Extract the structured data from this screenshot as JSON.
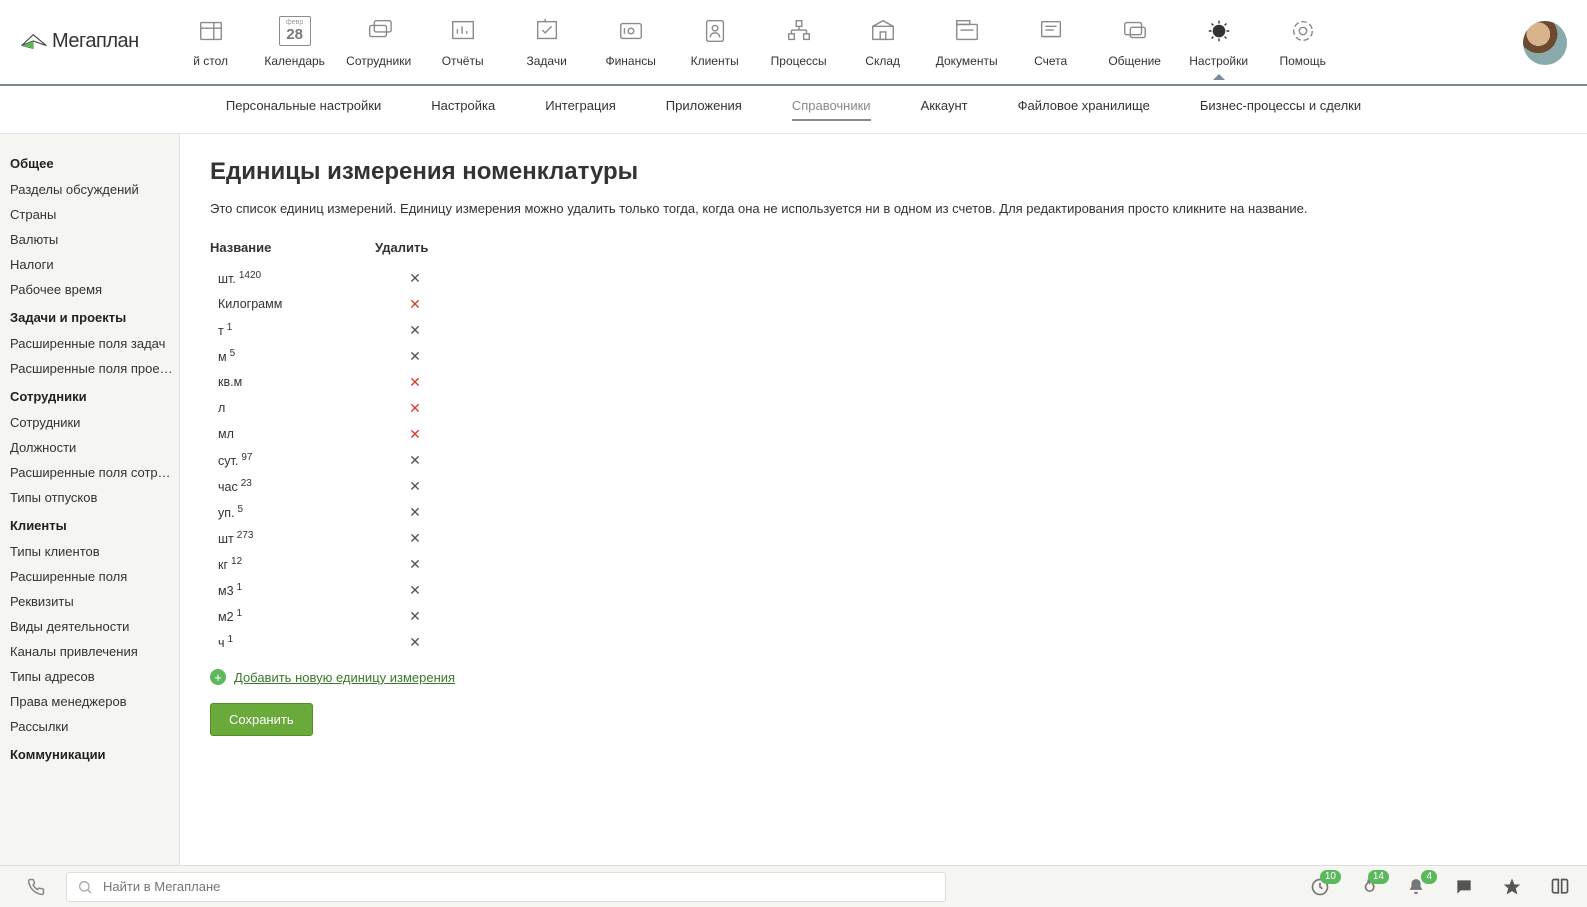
{
  "logo_text": "Мегаплан",
  "top_nav": [
    {
      "label": "й стол"
    },
    {
      "label": "Календарь",
      "badge": "28",
      "badge_top": "февр"
    },
    {
      "label": "Сотрудники"
    },
    {
      "label": "Отчёты"
    },
    {
      "label": "Задачи"
    },
    {
      "label": "Финансы"
    },
    {
      "label": "Клиенты"
    },
    {
      "label": "Процессы"
    },
    {
      "label": "Склад"
    },
    {
      "label": "Документы"
    },
    {
      "label": "Счета"
    },
    {
      "label": "Общение"
    },
    {
      "label": "Настройки",
      "active": true
    },
    {
      "label": "Помощь"
    }
  ],
  "sub_nav": [
    {
      "label": "Персональные настройки"
    },
    {
      "label": "Настройка"
    },
    {
      "label": "Интеграция"
    },
    {
      "label": "Приложения"
    },
    {
      "label": "Справочники",
      "active": true
    },
    {
      "label": "Аккаунт"
    },
    {
      "label": "Файловое хранилище"
    },
    {
      "label": "Бизнес-процессы и сделки"
    }
  ],
  "sidebar": [
    {
      "title": "Общее",
      "items": [
        "Разделы обсуждений",
        "Страны",
        "Валюты",
        "Налоги",
        "Рабочее время"
      ]
    },
    {
      "title": "Задачи и проекты",
      "items": [
        "Расширенные поля задач",
        "Расширенные поля проек..."
      ]
    },
    {
      "title": "Сотрудники",
      "items": [
        "Сотрудники",
        "Должности",
        "Расширенные поля сотру...",
        "Типы отпусков"
      ]
    },
    {
      "title": "Клиенты",
      "items": [
        "Типы клиентов",
        "Расширенные поля",
        "Реквизиты",
        "Виды деятельности",
        "Каналы привлечения",
        "Типы адресов",
        "Права менеджеров",
        "Рассылки"
      ]
    },
    {
      "title": "Коммуникации",
      "items": []
    }
  ],
  "page": {
    "title": "Единицы измерения номенклатуры",
    "desc": "Это список единиц измерений. Единицу измерения можно удалить только тогда, когда она не используется ни в одном из счетов. Для редактирования просто кликните на название.",
    "col_name": "Название",
    "col_del": "Удалить",
    "add_label": "Добавить новую единицу измерения",
    "save_label": "Сохранить"
  },
  "units": [
    {
      "name": "шт.",
      "count": "1420",
      "deletable": true
    },
    {
      "name": "Килограмм",
      "count": "",
      "deletable": false
    },
    {
      "name": "т",
      "count": "1",
      "deletable": true
    },
    {
      "name": "м",
      "count": "5",
      "deletable": true
    },
    {
      "name": "кв.м",
      "count": "",
      "deletable": false
    },
    {
      "name": "л",
      "count": "",
      "deletable": false
    },
    {
      "name": "мл",
      "count": "",
      "deletable": false
    },
    {
      "name": "сут.",
      "count": "97",
      "deletable": true
    },
    {
      "name": "час",
      "count": "23",
      "deletable": true
    },
    {
      "name": "уп.",
      "count": "5",
      "deletable": true
    },
    {
      "name": "шт",
      "count": "273",
      "deletable": true
    },
    {
      "name": "кг",
      "count": "12",
      "deletable": true
    },
    {
      "name": "м3",
      "count": "1",
      "deletable": true
    },
    {
      "name": "м2",
      "count": "1",
      "deletable": true
    },
    {
      "name": "ч",
      "count": "1",
      "deletable": true
    }
  ],
  "footer": {
    "search_placeholder": "Найти в Мегаплане",
    "badges": {
      "clock": "10",
      "fire": "14",
      "bell": "4"
    }
  }
}
